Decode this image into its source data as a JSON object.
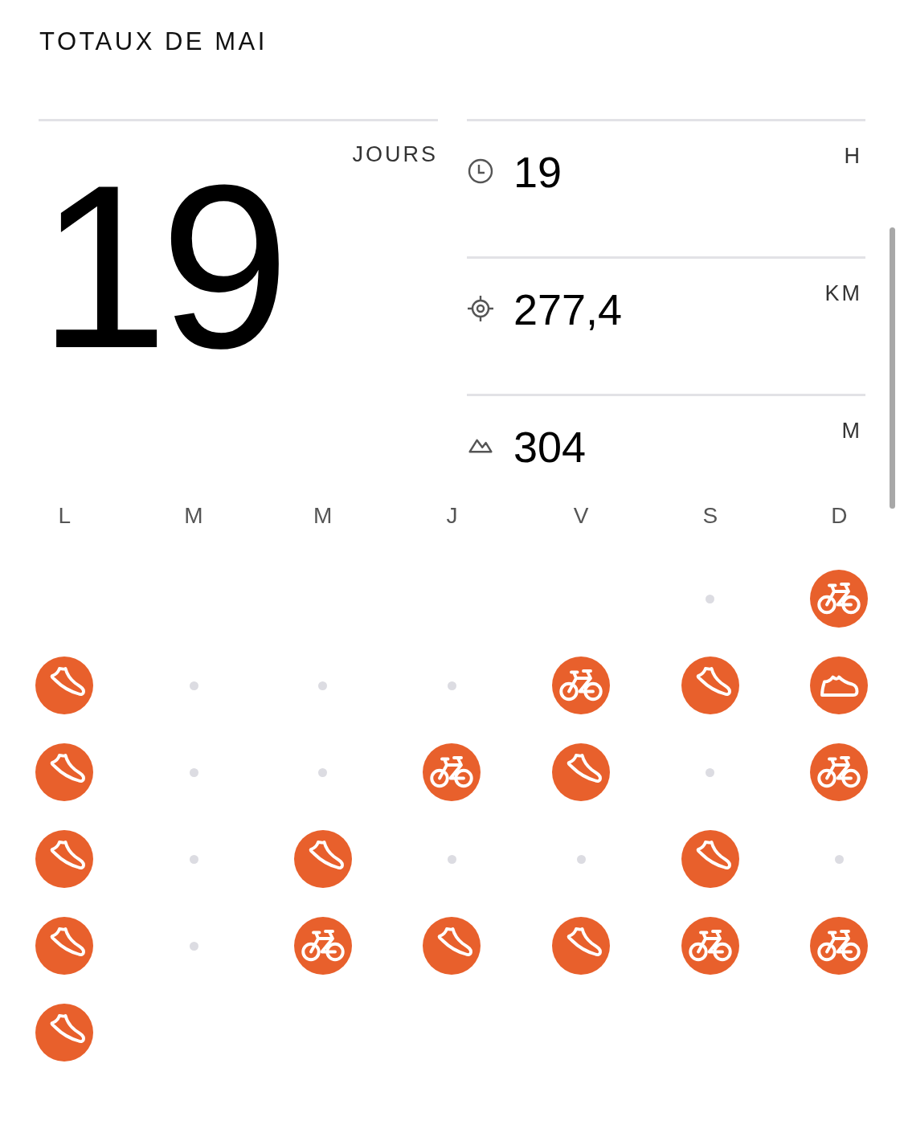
{
  "title": "TOTAUX DE MAI",
  "days_total": {
    "value": "19",
    "unit": "JOURS"
  },
  "stats": [
    {
      "kind": "time",
      "value": "19",
      "unit": "H"
    },
    {
      "kind": "distance",
      "value": "277,4",
      "unit": "KM"
    },
    {
      "kind": "elevation",
      "value": "304",
      "unit": "M"
    }
  ],
  "weekdays": [
    "L",
    "M",
    "M",
    "J",
    "V",
    "S",
    "D"
  ],
  "weeks": [
    {
      "days": [
        {
          "kind": "blank"
        },
        {
          "kind": "blank"
        },
        {
          "kind": "blank"
        },
        {
          "kind": "blank"
        },
        {
          "kind": "blank"
        },
        {
          "kind": "rest"
        },
        {
          "kind": "ride"
        }
      ]
    },
    {
      "days": [
        {
          "kind": "run"
        },
        {
          "kind": "rest"
        },
        {
          "kind": "rest"
        },
        {
          "kind": "rest"
        },
        {
          "kind": "ride"
        },
        {
          "kind": "run"
        },
        {
          "kind": "walk"
        }
      ]
    },
    {
      "days": [
        {
          "kind": "run"
        },
        {
          "kind": "rest"
        },
        {
          "kind": "rest"
        },
        {
          "kind": "ride"
        },
        {
          "kind": "run"
        },
        {
          "kind": "rest"
        },
        {
          "kind": "ride"
        }
      ]
    },
    {
      "days": [
        {
          "kind": "run"
        },
        {
          "kind": "rest"
        },
        {
          "kind": "run"
        },
        {
          "kind": "rest"
        },
        {
          "kind": "rest"
        },
        {
          "kind": "run"
        },
        {
          "kind": "rest"
        }
      ]
    },
    {
      "days": [
        {
          "kind": "run"
        },
        {
          "kind": "rest"
        },
        {
          "kind": "ride"
        },
        {
          "kind": "run"
        },
        {
          "kind": "run"
        },
        {
          "kind": "ride"
        },
        {
          "kind": "ride"
        }
      ]
    },
    {
      "days": [
        {
          "kind": "run"
        },
        {
          "kind": "blank"
        },
        {
          "kind": "blank"
        },
        {
          "kind": "blank"
        },
        {
          "kind": "blank"
        },
        {
          "kind": "blank"
        },
        {
          "kind": "blank"
        }
      ]
    }
  ]
}
